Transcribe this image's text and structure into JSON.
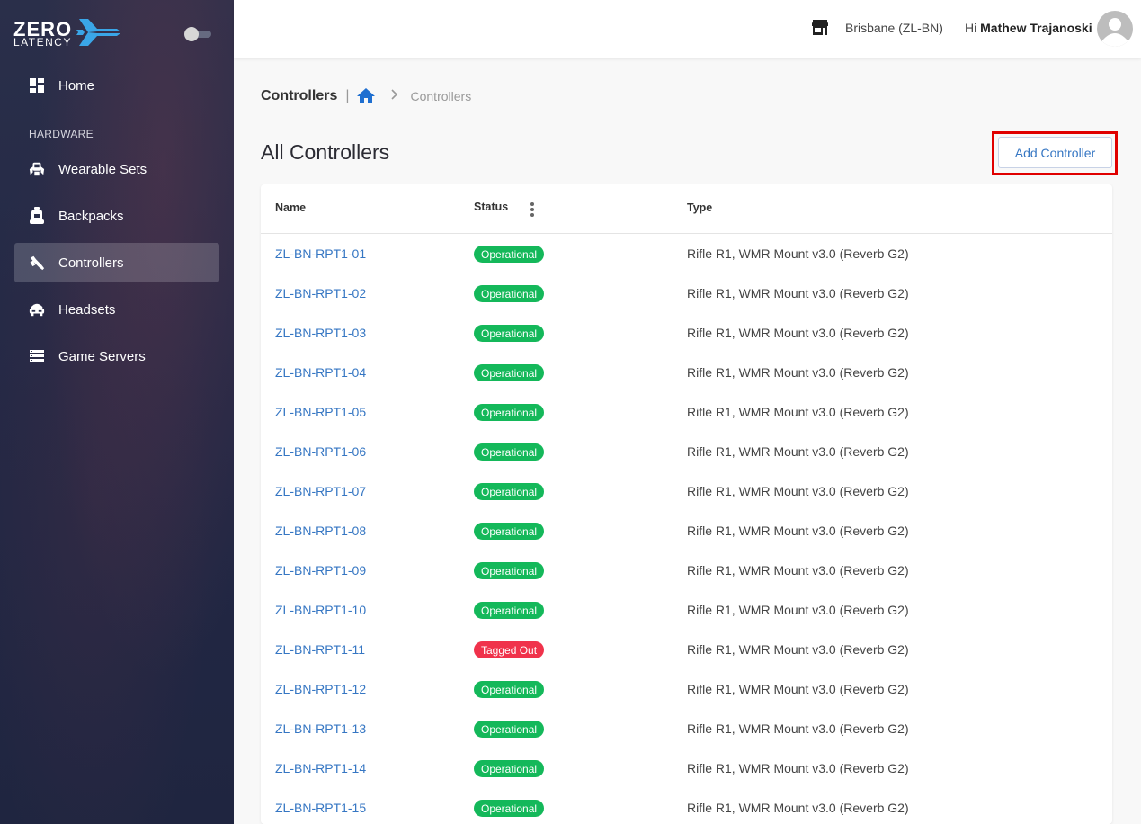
{
  "app": {
    "logo_top": "ZERO",
    "logo_bottom": "LATENCY"
  },
  "sidebar": {
    "section_label": "HARDWARE",
    "items": [
      {
        "label": "Home",
        "icon": "dashboard-icon",
        "active": false
      },
      {
        "label": "Wearable Sets",
        "icon": "wearable-icon",
        "active": false
      },
      {
        "label": "Backpacks",
        "icon": "backpack-icon",
        "active": false
      },
      {
        "label": "Controllers",
        "icon": "controller-icon",
        "active": true
      },
      {
        "label": "Headsets",
        "icon": "headset-icon",
        "active": false
      },
      {
        "label": "Game Servers",
        "icon": "server-icon",
        "active": false
      }
    ]
  },
  "header": {
    "location": "Brisbane (ZL-BN)",
    "greeting_prefix": "Hi",
    "user_name": "Mathew Trajanoski"
  },
  "breadcrumb": {
    "title": "Controllers",
    "separator": "|",
    "current": "Controllers"
  },
  "page": {
    "title": "All Controllers",
    "add_button": "Add Controller"
  },
  "table": {
    "columns": [
      "Name",
      "Status",
      "Type"
    ],
    "rows": [
      {
        "name": "ZL-BN-RPT1-01",
        "status": "Operational",
        "type": "Rifle R1, WMR Mount v3.0 (Reverb G2)"
      },
      {
        "name": "ZL-BN-RPT1-02",
        "status": "Operational",
        "type": "Rifle R1, WMR Mount v3.0 (Reverb G2)"
      },
      {
        "name": "ZL-BN-RPT1-03",
        "status": "Operational",
        "type": "Rifle R1, WMR Mount v3.0 (Reverb G2)"
      },
      {
        "name": "ZL-BN-RPT1-04",
        "status": "Operational",
        "type": "Rifle R1, WMR Mount v3.0 (Reverb G2)"
      },
      {
        "name": "ZL-BN-RPT1-05",
        "status": "Operational",
        "type": "Rifle R1, WMR Mount v3.0 (Reverb G2)"
      },
      {
        "name": "ZL-BN-RPT1-06",
        "status": "Operational",
        "type": "Rifle R1, WMR Mount v3.0 (Reverb G2)"
      },
      {
        "name": "ZL-BN-RPT1-07",
        "status": "Operational",
        "type": "Rifle R1, WMR Mount v3.0 (Reverb G2)"
      },
      {
        "name": "ZL-BN-RPT1-08",
        "status": "Operational",
        "type": "Rifle R1, WMR Mount v3.0 (Reverb G2)"
      },
      {
        "name": "ZL-BN-RPT1-09",
        "status": "Operational",
        "type": "Rifle R1, WMR Mount v3.0 (Reverb G2)"
      },
      {
        "name": "ZL-BN-RPT1-10",
        "status": "Operational",
        "type": "Rifle R1, WMR Mount v3.0 (Reverb G2)"
      },
      {
        "name": "ZL-BN-RPT1-11",
        "status": "Tagged Out",
        "type": "Rifle R1, WMR Mount v3.0 (Reverb G2)"
      },
      {
        "name": "ZL-BN-RPT1-12",
        "status": "Operational",
        "type": "Rifle R1, WMR Mount v3.0 (Reverb G2)"
      },
      {
        "name": "ZL-BN-RPT1-13",
        "status": "Operational",
        "type": "Rifle R1, WMR Mount v3.0 (Reverb G2)"
      },
      {
        "name": "ZL-BN-RPT1-14",
        "status": "Operational",
        "type": "Rifle R1, WMR Mount v3.0 (Reverb G2)"
      },
      {
        "name": "ZL-BN-RPT1-15",
        "status": "Operational",
        "type": "Rifle R1, WMR Mount v3.0 (Reverb G2)"
      }
    ]
  },
  "colors": {
    "accent": "#3576c3",
    "operational": "#14b85a",
    "tagged_out": "#f0324b",
    "highlight_frame": "#e00000",
    "sidebar": "#232845"
  }
}
